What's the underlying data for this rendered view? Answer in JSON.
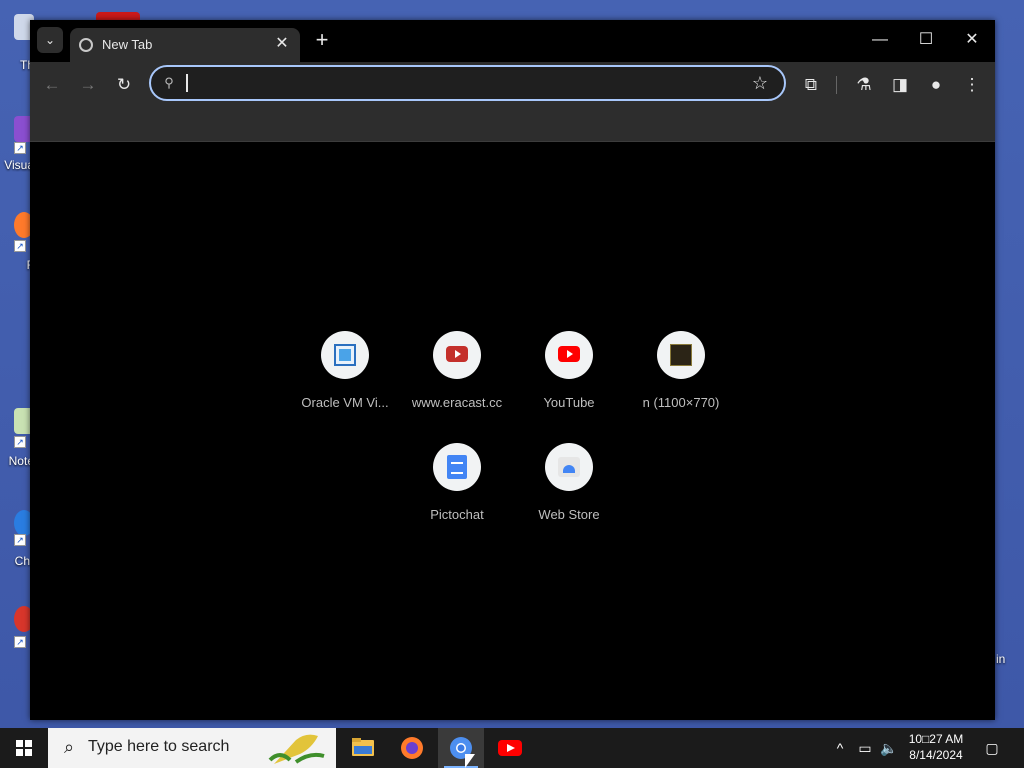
{
  "desktop": {
    "icons": [
      {
        "label": "Th"
      },
      {
        "label": "Visua"
      },
      {
        "label": "F"
      },
      {
        "label": "Note"
      },
      {
        "label": "Chr"
      },
      {
        "label": ""
      }
    ],
    "right_label": "in"
  },
  "browser": {
    "tab": {
      "title": "New Tab"
    },
    "omnibox": {
      "value": "",
      "placeholder": ""
    },
    "shortcuts": [
      {
        "label": "Oracle VM Vi...",
        "icon": "virtualbox-icon"
      },
      {
        "label": "www.eracast.cc",
        "icon": "youtube-icon"
      },
      {
        "label": "YouTube",
        "icon": "youtube-icon"
      },
      {
        "label": "n (1100×770)",
        "icon": "image-thumbnail-icon"
      },
      {
        "label": "Pictochat",
        "icon": "docs-icon"
      },
      {
        "label": "Web Store",
        "icon": "web-store-icon"
      }
    ]
  },
  "taskbar": {
    "search_placeholder": "Type here to search",
    "clock": {
      "time": "10□27 AM",
      "date": "8/14/2024"
    }
  },
  "colors": {
    "desktop_bg": "#4663b3",
    "window_bg": "#000000",
    "toolbar_bg": "#2d2d2d",
    "omnibox_border": "#a8c7fa",
    "youtube_red": "#ff0000",
    "dark_red": "#c4302b"
  }
}
